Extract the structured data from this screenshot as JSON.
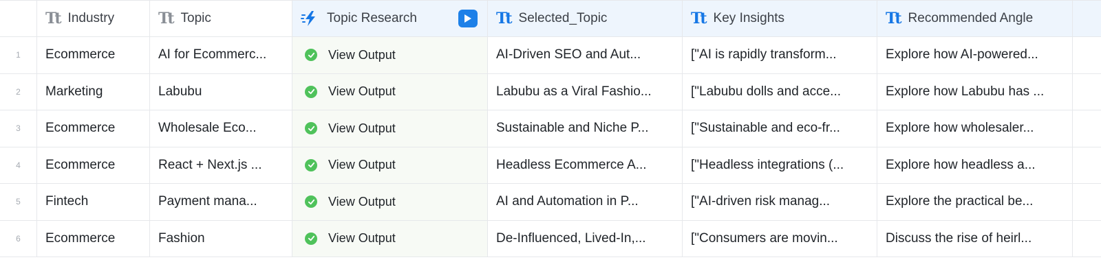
{
  "table": {
    "columns": [
      {
        "label": "Industry",
        "icon": "text-type-icon"
      },
      {
        "label": "Topic",
        "icon": "text-type-icon"
      },
      {
        "label": "Topic Research",
        "icon": "ai-bolt-icon"
      },
      {
        "label": "Selected_Topic",
        "icon": "text-type-icon"
      },
      {
        "label": "Key Insights",
        "icon": "text-type-icon"
      },
      {
        "label": "Recommended Angle",
        "icon": "text-type-icon"
      }
    ],
    "type_icon_text": "Tt",
    "rows": [
      {
        "num": "1",
        "industry": "Ecommerce",
        "topic": "AI for Ecommerc...",
        "research": "View Output",
        "selected_topic": "AI-Driven SEO and Aut...",
        "key_insights": "[\"AI is rapidly transform...",
        "recommended_angle": "Explore how AI-powered..."
      },
      {
        "num": "2",
        "industry": "Marketing",
        "topic": "Labubu",
        "research": "View Output",
        "selected_topic": "Labubu as a Viral Fashio...",
        "key_insights": "[\"Labubu dolls and acce...",
        "recommended_angle": "Explore how Labubu has ..."
      },
      {
        "num": "3",
        "industry": "Ecommerce",
        "topic": "Wholesale Eco...",
        "research": "View Output",
        "selected_topic": "Sustainable and Niche P...",
        "key_insights": "[\"Sustainable and eco-fr...",
        "recommended_angle": "Explore how wholesaler..."
      },
      {
        "num": "4",
        "industry": "Ecommerce",
        "topic": "React + Next.js ...",
        "research": "View Output",
        "selected_topic": "Headless Ecommerce A...",
        "key_insights": "[\"Headless integrations (...",
        "recommended_angle": "Explore how headless a..."
      },
      {
        "num": "5",
        "industry": "Fintech",
        "topic": "Payment mana...",
        "research": "View Output",
        "selected_topic": "AI and Automation in P...",
        "key_insights": "[\"AI-driven risk manag...",
        "recommended_angle": "Explore the practical be..."
      },
      {
        "num": "6",
        "industry": "Ecommerce",
        "topic": "Fashion",
        "research": "View Output",
        "selected_topic": "De-Influenced, Lived-In,...",
        "key_insights": "[\"Consumers are movin...",
        "recommended_angle": "Discuss the rise of heirl..."
      }
    ]
  },
  "colors": {
    "accent_blue": "#1677e5",
    "status_green": "#4fc25b",
    "header_tint": "#eef5fd"
  }
}
